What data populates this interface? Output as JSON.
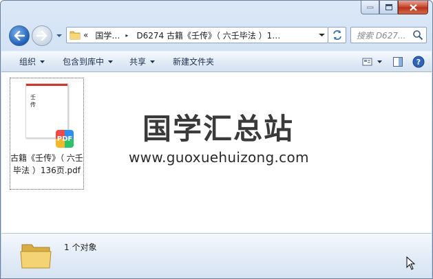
{
  "window": {
    "minimize_icon": "minimize-icon",
    "maximize_icon": "maximize-icon",
    "close_icon": "close-icon"
  },
  "address_bar": {
    "overflow_glyph": "«",
    "segments": [
      "国学…",
      "D6274 古籍《壬传》（ 六壬毕法 ）1…"
    ],
    "separator_glyph": "▸"
  },
  "search": {
    "placeholder": "搜索 D627..."
  },
  "toolbar": {
    "organize": "组织",
    "include_in_library": "包含到库中",
    "share": "共享",
    "new_folder": "新建文件夹"
  },
  "files": [
    {
      "name": "古籍《壬传》（ 六壬毕法 ）136页.pdf",
      "thumbnail_title": "壬传",
      "badge": "PDF"
    }
  ],
  "watermark": {
    "logo": "国学汇总站",
    "url": "www.guoxuehuizong.com"
  },
  "status": {
    "item_count": "1 个对象"
  },
  "colors": {
    "accent": "#1d5fb8",
    "close_red": "#c6432b",
    "toolbar_text": "#1e3150"
  }
}
